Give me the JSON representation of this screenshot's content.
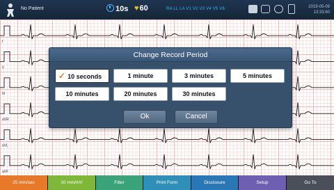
{
  "topbar": {
    "patient_label": "No Patient",
    "timer_value": "10s",
    "heart_rate": "60",
    "leads_text": "RA LL LA V1 V2 V3 V4 V5 V6",
    "date": "2019-05-09",
    "time": "13:33:60"
  },
  "dialog": {
    "title": "Change Record Period",
    "options": [
      "10 seconds",
      "1 minute",
      "3 minutes",
      "5 minutes",
      "10 minutes",
      "20 minutes",
      "30 minutes"
    ],
    "selected": "10 seconds",
    "ok_label": "Ok",
    "cancel_label": "Cancel"
  },
  "ecg_leads": [
    "I",
    "II",
    "III",
    "aVR",
    "aVL",
    "aVF"
  ],
  "bottom_buttons": [
    {
      "label": "25 mm/sec",
      "color": "#e8782a"
    },
    {
      "label": "10 mm/mV",
      "color": "#7fb838"
    },
    {
      "label": "Filter",
      "color": "#3aa37a"
    },
    {
      "label": "Print Form",
      "color": "#2f8fb8"
    },
    {
      "label": "Disclosure",
      "color": "#2a77b5"
    },
    {
      "label": "Setup",
      "color": "#6f5fb3"
    },
    {
      "label": "Go To",
      "color": "#4a4f5a"
    }
  ]
}
